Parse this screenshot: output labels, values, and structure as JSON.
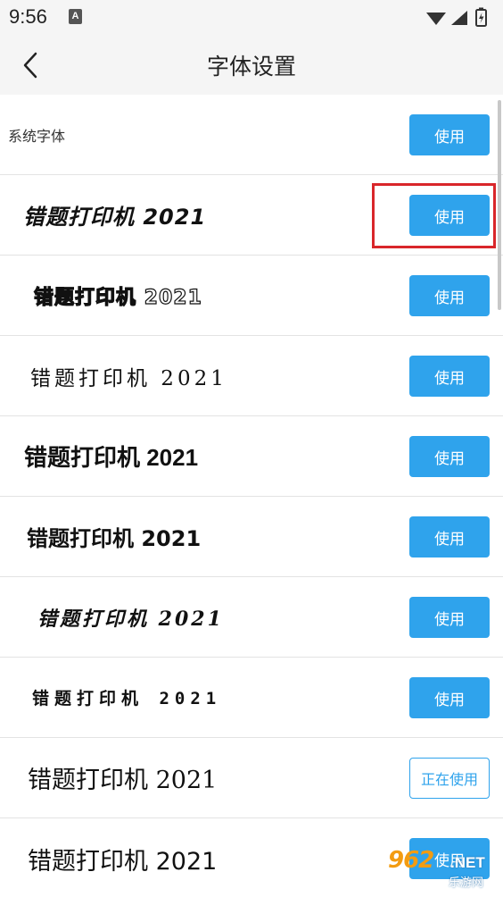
{
  "status": {
    "time": "9:56",
    "badge": "A"
  },
  "header": {
    "title": "字体设置"
  },
  "rows": [
    {
      "label": "系统字体",
      "button": "使用"
    },
    {
      "label": "错题打印机 2021",
      "button": "使用"
    },
    {
      "label": "错题打印机 2021",
      "button": "使用"
    },
    {
      "label": "错题打印机 2021",
      "button": "使用"
    },
    {
      "label": "错题打印机 2021",
      "button": "使用"
    },
    {
      "label": "错题打印机 2021",
      "button": "使用"
    },
    {
      "label": "错题打印机 2021",
      "button": "使用"
    },
    {
      "label": "错题打印机 2021",
      "button": "使用"
    },
    {
      "label": "错题打印机 2021",
      "button": "正在使用"
    },
    {
      "label": "错题打印机 2021",
      "button": "使用"
    }
  ],
  "watermark": {
    "number": "962",
    "domain": ".NET",
    "caption": "乐游网"
  },
  "colors": {
    "accent": "#2fa3ec",
    "highlight": "#d9262a",
    "background": "#ffffff",
    "appbar": "#f5f5f5"
  }
}
